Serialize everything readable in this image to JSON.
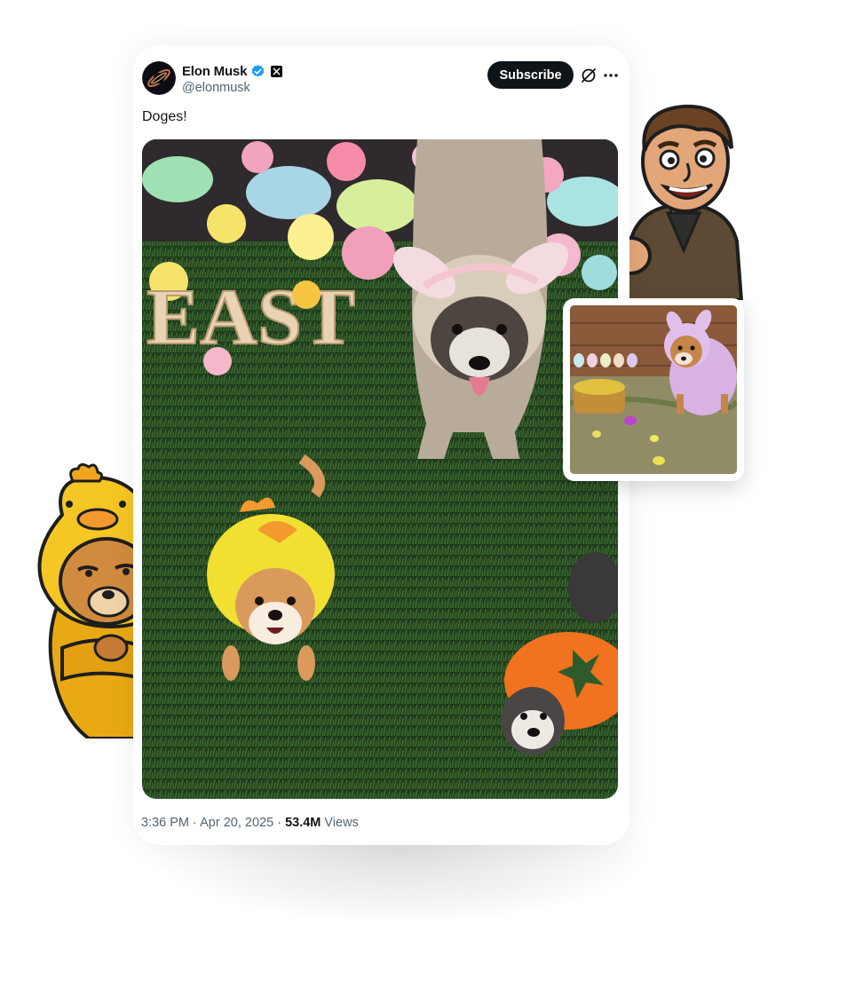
{
  "tweet": {
    "author_name": "Elon Musk",
    "handle": "@elonmusk",
    "subscribe_label": "Subscribe",
    "text": "Doges!",
    "media_sign_text": "EAST",
    "time": "3:36 PM",
    "separator": "·",
    "date": "Apr 20, 2025",
    "views_count": "53.4M",
    "views_label": "Views"
  },
  "icons": {
    "verified": "verified-badge-icon",
    "affiliate": "x-logo-icon",
    "grok": "grok-icon",
    "more": "more-icon"
  },
  "colors": {
    "text_primary": "#0f1419",
    "text_secondary": "#536471",
    "verified_blue": "#1d9bf0",
    "button_bg": "#0f1419"
  }
}
